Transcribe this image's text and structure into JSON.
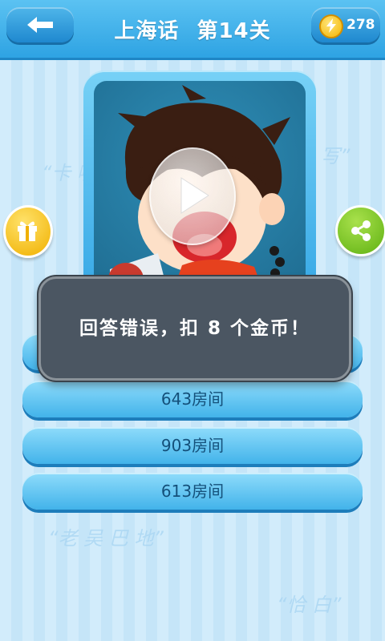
{
  "header": {
    "title_left": "上海话",
    "title_right": "第14关",
    "coins": "278",
    "back_icon": "back-arrow-icon",
    "coin_icon": "lightning-coin-icon"
  },
  "question": {
    "play_icon": "play-icon"
  },
  "side_buttons": {
    "gift_icon": "gift-icon",
    "share_icon": "share-icon"
  },
  "answers": [
    {
      "label": ""
    },
    {
      "label": "643房间"
    },
    {
      "label": "903房间"
    },
    {
      "label": "613房间"
    }
  ],
  "toast": {
    "message": "回答错误，扣 8 个金币！"
  },
  "colors": {
    "header": "#2ea3e3",
    "answer_button": "#42b3ea",
    "toast_bg": "#4b5662",
    "gift": "#f0b000",
    "share": "#5fb112"
  }
}
